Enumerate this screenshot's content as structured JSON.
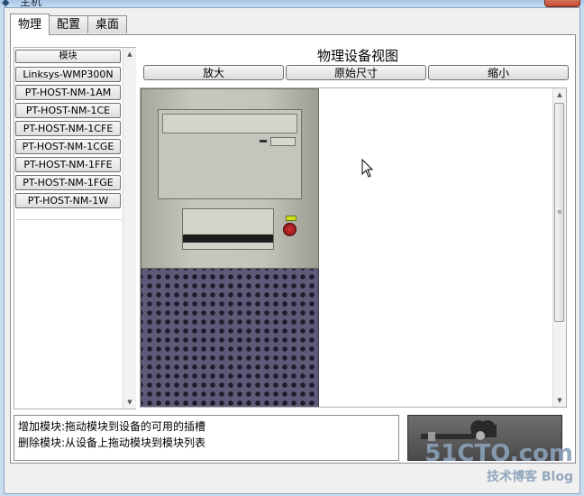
{
  "window": {
    "title": "主机"
  },
  "tabs": [
    {
      "label": "物理"
    },
    {
      "label": "配置"
    },
    {
      "label": "桌面"
    }
  ],
  "modules": {
    "header": "模块",
    "items": [
      "Linksys-WMP300N",
      "PT-HOST-NM-1AM",
      "PT-HOST-NM-1CE",
      "PT-HOST-NM-1CFE",
      "PT-HOST-NM-1CGE",
      "PT-HOST-NM-1FFE",
      "PT-HOST-NM-1FGE",
      "PT-HOST-NM-1W"
    ]
  },
  "view": {
    "title": "物理设备视图",
    "zoom_in": "放大",
    "original_size": "原始尺寸",
    "zoom_out": "缩小"
  },
  "hints": {
    "add": "增加模块:拖动模块到设备的可用的插槽",
    "remove": "删除模块:从设备上拖动模块到模块列表"
  },
  "watermark": {
    "line1": "51CTO.com",
    "line2": "技术博客 Blog"
  },
  "colors": {
    "window_bg": "#f0f0f0",
    "case_silver": "#c3c4ba",
    "case_grille": "#5c5a78",
    "power_red": "#d23030",
    "led_green": "#c8e020"
  }
}
